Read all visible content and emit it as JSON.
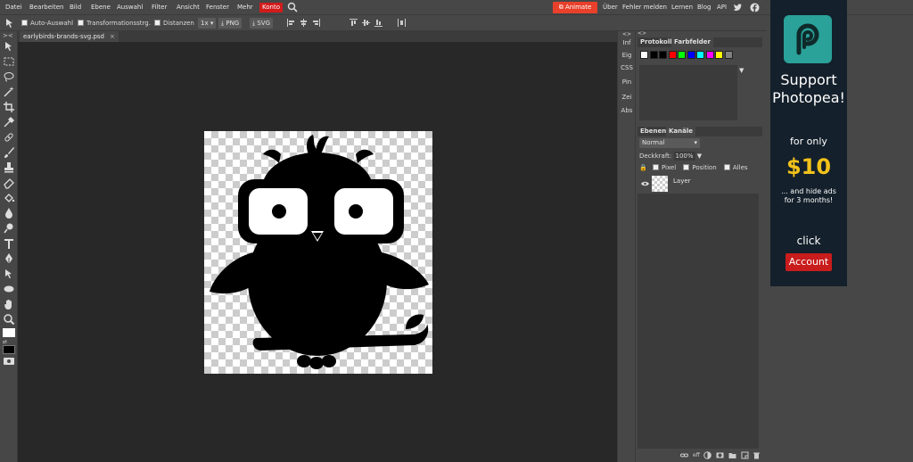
{
  "menu": {
    "items": [
      "Datei",
      "Bearbeiten",
      "Bild",
      "Ebene",
      "Auswahl",
      "Filter",
      "Ansicht",
      "Fenster",
      "Mehr",
      "Konto"
    ]
  },
  "topright": {
    "animate_label": "Animate",
    "links": [
      "Über",
      "Fehler melden",
      "Lernen",
      "Blog",
      "API"
    ]
  },
  "options": {
    "auto_select": "Auto-Auswahl",
    "transform": "Transformationsstrg.",
    "distances": "Distanzen",
    "scale": "1x",
    "png": "PNG",
    "svg": "SVG"
  },
  "document": {
    "tab_title": "earlybirds-brands-svg.psd",
    "close": "×"
  },
  "mini_panel": [
    "Inf",
    "Eig",
    "CSS",
    "Pin",
    "Zei",
    "Abs"
  ],
  "history_panel": {
    "tabs": [
      "Protokoll",
      "Farbfelder"
    ],
    "swatches": [
      "#ffffff",
      "#000000",
      "#000000",
      "#ff0000",
      "#00ff00",
      "#0000ff",
      "#00ffff",
      "#ff00ff",
      "#ffff00",
      "#808080"
    ]
  },
  "layers_panel": {
    "tabs": [
      "Ebenen",
      "Kanäle"
    ],
    "blend_mode": "Normal",
    "opacity_label": "Deckkraft:",
    "opacity_value": "100%",
    "lock_options": [
      "Pixel",
      "Position",
      "Alles"
    ],
    "layers": [
      {
        "name": "Layer",
        "visible": true
      }
    ]
  },
  "ad": {
    "line1": "Support",
    "line2": "Photopea!",
    "for_only": "for only",
    "price": "$10",
    "hide_line1": "... and hide ads",
    "hide_line2": "for 3 months!",
    "click": "click",
    "button": "Account"
  },
  "colors": {
    "accent_red": "#d21b1b",
    "animate_orange": "#e8402a",
    "ad_bg": "#14202b",
    "ad_logo": "#2aa199",
    "ad_price": "#f2c21b"
  }
}
